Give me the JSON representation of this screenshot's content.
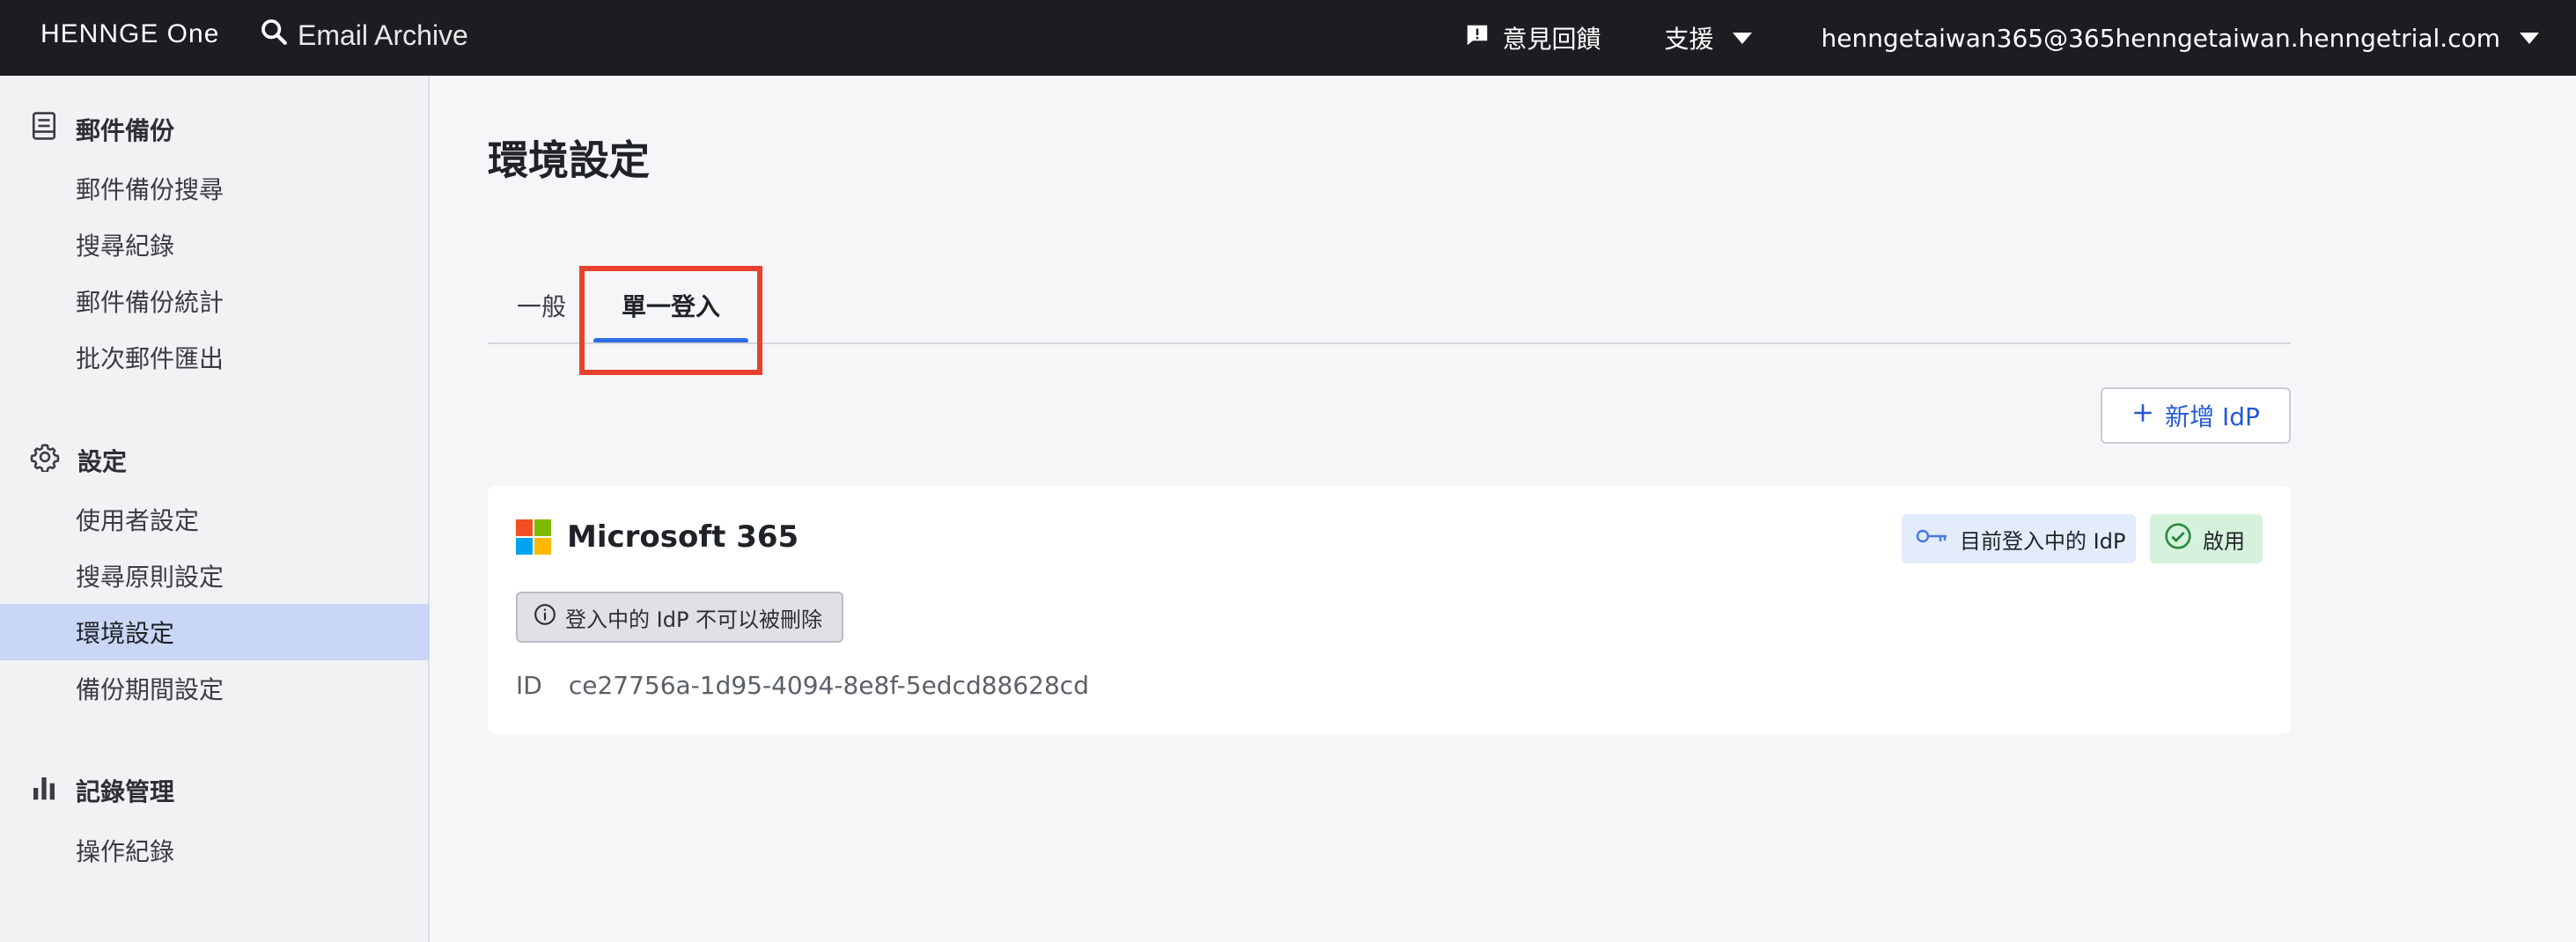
{
  "topbar": {
    "logo": "HENNGE One",
    "app_name": "Email Archive",
    "feedback": "意見回饋",
    "support": "支援",
    "account": "henngetaiwan365@365henngetaiwan.henngetrial.com"
  },
  "sidebar": {
    "sections": [
      {
        "title": "郵件備份",
        "icon": "archive-icon",
        "items": [
          "郵件備份搜尋",
          "搜尋紀錄",
          "郵件備份統計",
          "批次郵件匯出"
        ]
      },
      {
        "title": "設定",
        "icon": "gear-icon",
        "items": [
          "使用者設定",
          "搜尋原則設定",
          "環境設定",
          "備份期間設定"
        ]
      },
      {
        "title": "記錄管理",
        "icon": "bar-chart-icon",
        "items": [
          "操作紀錄"
        ]
      }
    ],
    "active_item": "環境設定"
  },
  "main": {
    "title": "環境設定",
    "tabs": [
      {
        "label": "一般",
        "selected": false
      },
      {
        "label": "單一登入",
        "selected": true
      }
    ],
    "add_idp_label": "新增 IdP",
    "idp_card": {
      "name": "Microsoft 365",
      "current_badge": "目前登入中的 IdP",
      "status_badge": "啟用",
      "notice": "登入中的 IdP 不可以被刪除",
      "id_label": "ID",
      "id_value": "ce27756a-1d95-4094-8e8f-5edcd88628cd"
    }
  },
  "colors": {
    "topbar": "#1c1d21",
    "accent": "#2e6be6",
    "active_nav": "#c9d6f5",
    "highlight": "#e8412c",
    "enabled_badge": "#d7f2dc",
    "current_badge": "#e3ecfb"
  }
}
